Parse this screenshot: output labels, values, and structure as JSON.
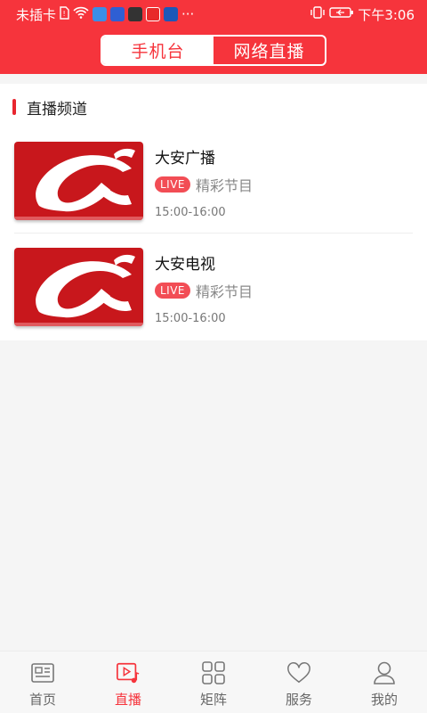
{
  "status_bar": {
    "carrier": "未插卡",
    "more": "···",
    "time": "下午3:06"
  },
  "colors": {
    "brand_red": "#f6343c",
    "live_badge": "#f24d55",
    "thumb_red": "#c8171c"
  },
  "top_tabs": {
    "tab1_label": "手机台",
    "tab2_label": "网络直播",
    "active": "tab1"
  },
  "section": {
    "title": "直播频道"
  },
  "channels": [
    {
      "name": "大安广播",
      "live": "LIVE",
      "program": "精彩节目",
      "time": "15:00-16:00"
    },
    {
      "name": "大安电视",
      "live": "LIVE",
      "program": "精彩节目",
      "time": "15:00-16:00"
    }
  ],
  "bottom_nav": {
    "items": [
      {
        "label": "首页",
        "icon": "news-icon"
      },
      {
        "label": "直播",
        "icon": "live-video-icon"
      },
      {
        "label": "矩阵",
        "icon": "grid-icon"
      },
      {
        "label": "服务",
        "icon": "heart-icon"
      },
      {
        "label": "我的",
        "icon": "user-icon"
      }
    ],
    "active_index": 1
  }
}
